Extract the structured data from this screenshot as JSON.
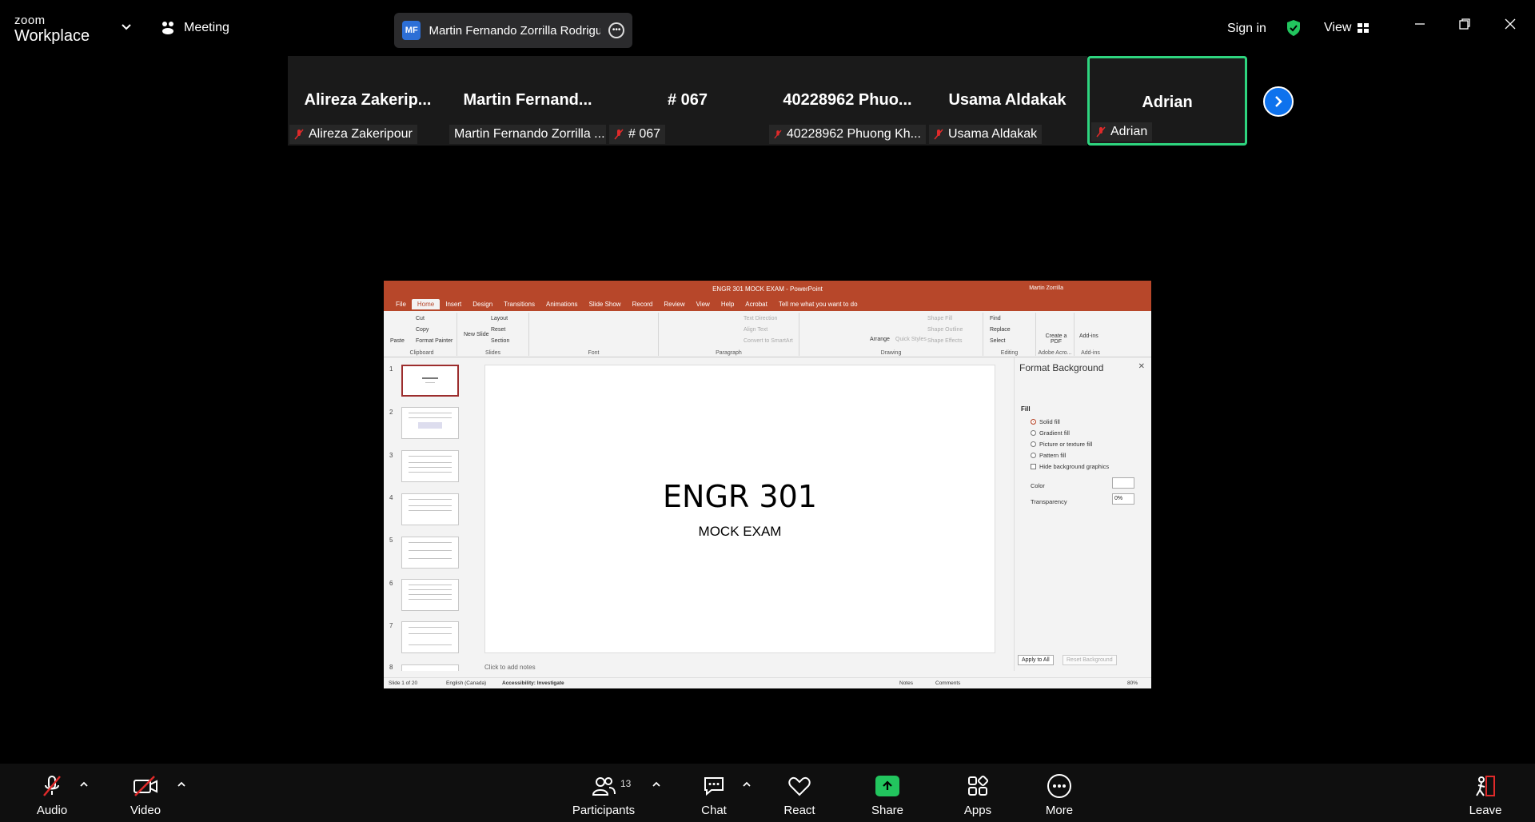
{
  "app": {
    "brand_line1": "zoom",
    "brand_line2": "Workplace"
  },
  "topbar": {
    "meeting_label": "Meeting",
    "speaker": {
      "initials": "MF",
      "name": "Martin Fernando Zorrilla Rodrigu"
    },
    "sign_in": "Sign in",
    "view": "View"
  },
  "gallery": {
    "tiles": [
      {
        "big": "Alireza  Zakerip...",
        "label": "Alireza Zakeripour",
        "muted": true
      },
      {
        "big": "Martin  Fernand...",
        "label": "Martin Fernando Zorrilla ...",
        "muted": false
      },
      {
        "big": "# 067",
        "label": "# 067",
        "muted": true
      },
      {
        "big": "40228962  Phuo...",
        "label": "40228962 Phuong Kh...",
        "muted": true
      },
      {
        "big": "Usama Aldakak",
        "label": "Usama Aldakak",
        "muted": true
      },
      {
        "big": "Adrian",
        "label": "Adrian",
        "muted": true,
        "active": true
      }
    ]
  },
  "powerpoint": {
    "window_title": "ENGR 301 MOCK EXAM  -  PowerPoint",
    "user": "Martin Zorrilla",
    "tabs": [
      "File",
      "Home",
      "Insert",
      "Design",
      "Transitions",
      "Animations",
      "Slide Show",
      "Record",
      "Review",
      "View",
      "Help",
      "Acrobat",
      "Tell me what you want to do"
    ],
    "ribbon": {
      "paste": "Paste",
      "cut": "Cut",
      "copy": "Copy",
      "format_painter": "Format Painter",
      "clipboard": "Clipboard",
      "new_slide": "New Slide",
      "layout": "Layout",
      "reset": "Reset",
      "section": "Section",
      "slides": "Slides",
      "font": "Font",
      "paragraph": "Paragraph",
      "text_direction": "Text Direction",
      "align_text": "Align Text",
      "convert_smartart": "Convert to SmartArt",
      "arrange": "Arrange",
      "quick_styles": "Quick Styles",
      "shape_fill": "Shape Fill",
      "shape_outline": "Shape Outline",
      "shape_effects": "Shape Effects",
      "drawing": "Drawing",
      "find": "Find",
      "replace": "Replace",
      "select": "Select",
      "editing": "Editing",
      "create_pdf": "Create a PDF",
      "adobe_acrobat": "Adobe Acro...",
      "addins": "Add-ins",
      "addins_group": "Add-ins"
    },
    "slide_numbers": [
      "1",
      "2",
      "3",
      "4",
      "5",
      "6",
      "7",
      "8"
    ],
    "slide_title": "ENGR 301",
    "slide_subtitle": "MOCK EXAM",
    "notes_placeholder": "Click to add notes",
    "format_background": {
      "title": "Format Background",
      "fill": "Fill",
      "options": [
        "Solid fill",
        "Gradient fill",
        "Picture or texture fill",
        "Pattern fill"
      ],
      "selected": "Solid fill",
      "hide_graphics": "Hide background graphics",
      "color": "Color",
      "transparency": "Transparency",
      "transparency_value": "0%",
      "apply_all": "Apply to All",
      "reset_bg": "Reset Background"
    },
    "status": {
      "slide": "Slide 1 of 20",
      "language": "English (Canada)",
      "accessibility": "Accessibility: Investigate",
      "notes": "Notes",
      "comments": "Comments",
      "zoom": "80%"
    }
  },
  "toolbar": {
    "audio": "Audio",
    "video": "Video",
    "participants": "Participants",
    "participants_count": "13",
    "chat": "Chat",
    "react": "React",
    "share": "Share",
    "apps": "Apps",
    "more": "More",
    "leave": "Leave"
  },
  "colors": {
    "accent_green": "#2ed57f",
    "zoom_blue": "#0e72ed",
    "ppt_red": "#b7472a",
    "share_green": "#22c55e",
    "mute_red": "#e02a2a"
  }
}
